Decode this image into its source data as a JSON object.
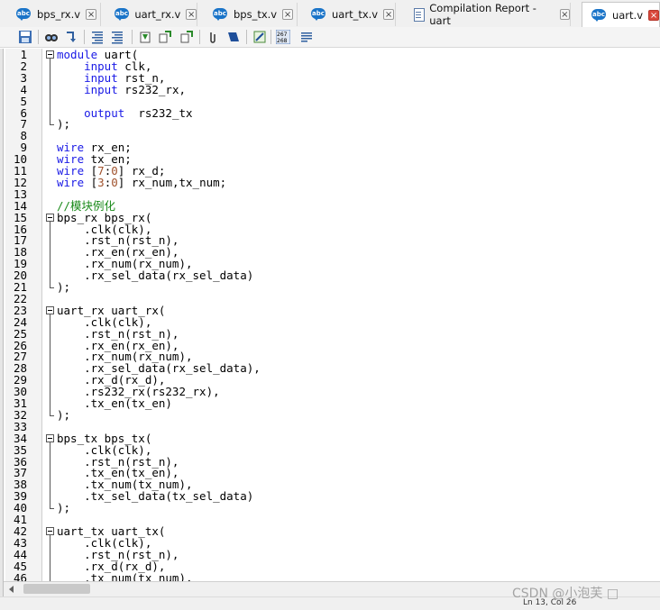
{
  "tabs": [
    {
      "label": "bps_rx.v",
      "icon": "verilog-file-icon",
      "active": false
    },
    {
      "label": "uart_rx.v",
      "icon": "verilog-file-icon",
      "active": false
    },
    {
      "label": "bps_tx.v",
      "icon": "verilog-file-icon",
      "active": false
    },
    {
      "label": "uart_tx.v",
      "icon": "verilog-file-icon",
      "active": false
    },
    {
      "label": "Compilation Report - uart",
      "icon": "report-icon",
      "active": false
    },
    {
      "label": "uart.v",
      "icon": "verilog-file-icon",
      "active": true
    }
  ],
  "toolbar": {
    "items": [
      "save-icon",
      "find-icon",
      "replace-icon",
      "indent-icon",
      "unindent-icon",
      "bookmark-icon",
      "prev-bookmark-icon",
      "next-bookmark-icon",
      "attach-icon",
      "insert-template-icon",
      "insert-block-icon",
      "line-numbers-icon",
      "comment-icon"
    ],
    "line_numbers_label": "267\n268"
  },
  "colors": {
    "keyword": "#1a1ae6",
    "comment": "#1a8a1a",
    "number": "#a0522d"
  },
  "code": {
    "lines": [
      {
        "n": "1",
        "tokens": [
          [
            "kw",
            "module"
          ],
          [
            "id",
            " uart("
          ]
        ]
      },
      {
        "n": "2",
        "tokens": [
          [
            "id",
            "    "
          ],
          [
            "kw",
            "input"
          ],
          [
            "id",
            " clk,"
          ]
        ]
      },
      {
        "n": "3",
        "tokens": [
          [
            "id",
            "    "
          ],
          [
            "kw",
            "input"
          ],
          [
            "id",
            " rst_n,"
          ]
        ]
      },
      {
        "n": "4",
        "tokens": [
          [
            "id",
            "    "
          ],
          [
            "kw",
            "input"
          ],
          [
            "id",
            " rs232_rx,"
          ]
        ]
      },
      {
        "n": "5",
        "tokens": []
      },
      {
        "n": "6",
        "tokens": [
          [
            "id",
            "    "
          ],
          [
            "kw",
            "output"
          ],
          [
            "id",
            "  rs232_tx"
          ]
        ]
      },
      {
        "n": "7",
        "tokens": [
          [
            "id",
            ");"
          ]
        ]
      },
      {
        "n": "8",
        "tokens": []
      },
      {
        "n": "9",
        "tokens": [
          [
            "kw",
            "wire"
          ],
          [
            "id",
            " rx_en;"
          ]
        ]
      },
      {
        "n": "10",
        "tokens": [
          [
            "kw",
            "wire"
          ],
          [
            "id",
            " tx_en;"
          ]
        ]
      },
      {
        "n": "11",
        "tokens": [
          [
            "kw",
            "wire"
          ],
          [
            "id",
            " ["
          ],
          [
            "nm",
            "7"
          ],
          [
            "id",
            ":"
          ],
          [
            "nm",
            "0"
          ],
          [
            "id",
            "] rx_d;"
          ]
        ]
      },
      {
        "n": "12",
        "tokens": [
          [
            "kw",
            "wire"
          ],
          [
            "id",
            " ["
          ],
          [
            "nm",
            "3"
          ],
          [
            "id",
            ":"
          ],
          [
            "nm",
            "0"
          ],
          [
            "id",
            "] rx_num,tx_num;"
          ]
        ]
      },
      {
        "n": "13",
        "tokens": []
      },
      {
        "n": "14",
        "tokens": [
          [
            "cm",
            "//模块例化"
          ]
        ]
      },
      {
        "n": "15",
        "tokens": [
          [
            "id",
            "bps_rx bps_rx("
          ]
        ]
      },
      {
        "n": "16",
        "tokens": [
          [
            "id",
            "    .clk(clk),"
          ]
        ]
      },
      {
        "n": "17",
        "tokens": [
          [
            "id",
            "    .rst_n(rst_n),"
          ]
        ]
      },
      {
        "n": "18",
        "tokens": [
          [
            "id",
            "    .rx_en(rx_en),"
          ]
        ]
      },
      {
        "n": "19",
        "tokens": [
          [
            "id",
            "    .rx_num(rx_num),"
          ]
        ]
      },
      {
        "n": "20",
        "tokens": [
          [
            "id",
            "    .rx_sel_data(rx_sel_data)"
          ]
        ]
      },
      {
        "n": "21",
        "tokens": [
          [
            "id",
            ");"
          ]
        ]
      },
      {
        "n": "22",
        "tokens": []
      },
      {
        "n": "23",
        "tokens": [
          [
            "id",
            "uart_rx uart_rx("
          ]
        ]
      },
      {
        "n": "24",
        "tokens": [
          [
            "id",
            "    .clk(clk),"
          ]
        ]
      },
      {
        "n": "25",
        "tokens": [
          [
            "id",
            "    .rst_n(rst_n),"
          ]
        ]
      },
      {
        "n": "26",
        "tokens": [
          [
            "id",
            "    .rx_en(rx_en),"
          ]
        ]
      },
      {
        "n": "27",
        "tokens": [
          [
            "id",
            "    .rx_num(rx_num),"
          ]
        ]
      },
      {
        "n": "28",
        "tokens": [
          [
            "id",
            "    .rx_sel_data(rx_sel_data),"
          ]
        ]
      },
      {
        "n": "29",
        "tokens": [
          [
            "id",
            "    .rx_d(rx_d),"
          ]
        ]
      },
      {
        "n": "30",
        "tokens": [
          [
            "id",
            "    .rs232_rx(rs232_rx),"
          ]
        ]
      },
      {
        "n": "31",
        "tokens": [
          [
            "id",
            "    .tx_en(tx_en)"
          ]
        ]
      },
      {
        "n": "32",
        "tokens": [
          [
            "id",
            ");"
          ]
        ]
      },
      {
        "n": "33",
        "tokens": []
      },
      {
        "n": "34",
        "tokens": [
          [
            "id",
            "bps_tx bps_tx("
          ]
        ]
      },
      {
        "n": "35",
        "tokens": [
          [
            "id",
            "    .clk(clk),"
          ]
        ]
      },
      {
        "n": "36",
        "tokens": [
          [
            "id",
            "    .rst_n(rst_n),"
          ]
        ]
      },
      {
        "n": "37",
        "tokens": [
          [
            "id",
            "    .tx_en(tx_en),"
          ]
        ]
      },
      {
        "n": "38",
        "tokens": [
          [
            "id",
            "    .tx_num(tx_num),"
          ]
        ]
      },
      {
        "n": "39",
        "tokens": [
          [
            "id",
            "    .tx_sel_data(tx_sel_data)"
          ]
        ]
      },
      {
        "n": "40",
        "tokens": [
          [
            "id",
            ");"
          ]
        ]
      },
      {
        "n": "41",
        "tokens": []
      },
      {
        "n": "42",
        "tokens": [
          [
            "id",
            "uart_tx uart_tx("
          ]
        ]
      },
      {
        "n": "43",
        "tokens": [
          [
            "id",
            "    .clk(clk),"
          ]
        ]
      },
      {
        "n": "44",
        "tokens": [
          [
            "id",
            "    .rst_n(rst_n),"
          ]
        ]
      },
      {
        "n": "45",
        "tokens": [
          [
            "id",
            "    .rx_d(rx_d),"
          ]
        ]
      },
      {
        "n": "46",
        "tokens": [
          [
            "id",
            "    .tx_num(tx_num),"
          ]
        ]
      }
    ],
    "folds": [
      {
        "start": "1",
        "end": "7"
      },
      {
        "start": "15",
        "end": "21"
      },
      {
        "start": "23",
        "end": "32"
      },
      {
        "start": "34",
        "end": "40"
      },
      {
        "start": "42",
        "end": "47"
      }
    ]
  },
  "status": {
    "line_col": "Ln 13, Col 26"
  },
  "watermark": "CSDN @小泡芙 □"
}
